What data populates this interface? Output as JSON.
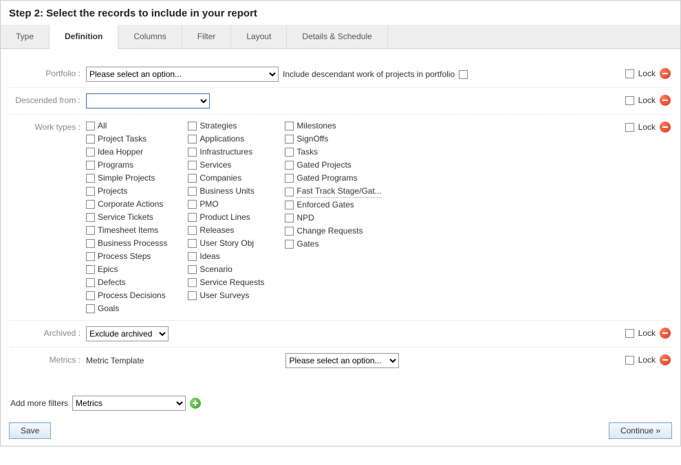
{
  "header": {
    "title": "Step 2: Select the records to include in your report"
  },
  "tabs": [
    {
      "label": "Type",
      "active": false
    },
    {
      "label": "Definition",
      "active": true
    },
    {
      "label": "Columns",
      "active": false
    },
    {
      "label": "Filter",
      "active": false
    },
    {
      "label": "Layout",
      "active": false
    },
    {
      "label": "Details & Schedule",
      "active": false
    }
  ],
  "fields": {
    "portfolio": {
      "label": "Portfolio :",
      "placeholder": "Please select an option...",
      "include_desc_label": "Include descendant work of projects in portfolio",
      "lock_label": "Lock"
    },
    "descended": {
      "label": "Descended from :",
      "value": "",
      "lock_label": "Lock"
    },
    "work_types": {
      "label": "Work types :",
      "lock_label": "Lock",
      "col1": [
        "All",
        "Project Tasks",
        "Idea Hopper",
        "Programs",
        "Simple Projects",
        "Projects",
        "Corporate Actions",
        "Service Tickets",
        "Timesheet Items",
        "Business Processs",
        "Process Steps",
        "Epics",
        "Defects",
        "Process Decisions",
        "Goals"
      ],
      "col2": [
        "Strategies",
        "Applications",
        "Infrastructures",
        "Services",
        "Companies",
        "Business Units",
        "PMO",
        "Product Lines",
        "Releases",
        "User Story Obj",
        "Ideas",
        "Scenario",
        "Service Requests",
        "User Surveys"
      ],
      "col3": [
        "Milestones",
        "SignOffs",
        "Tasks",
        "Gated Projects",
        "Gated Programs",
        "Fast Track Stage/Gat...",
        "Enforced Gates",
        "NPD",
        "Change Requests",
        "Gates"
      ]
    },
    "archived": {
      "label": "Archived :",
      "value": "Exclude archived",
      "lock_label": "Lock"
    },
    "metrics": {
      "label": "Metrics :",
      "template_label": "Metric Template",
      "placeholder": "Please select an option...",
      "lock_label": "Lock"
    }
  },
  "filter_bar": {
    "label": "Add more filters",
    "value": "Metrics"
  },
  "footer": {
    "save": "Save",
    "continue": "Continue »"
  }
}
